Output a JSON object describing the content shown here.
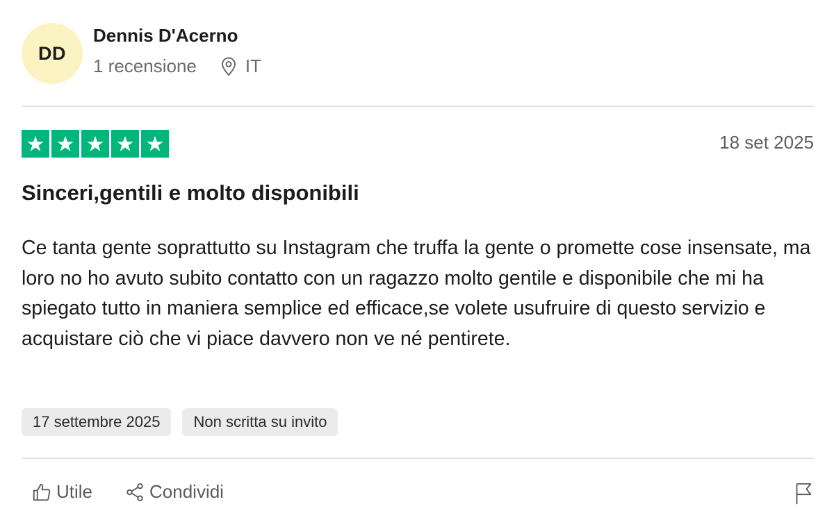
{
  "reviewer": {
    "initials": "DD",
    "name": "Dennis D'Acerno",
    "review_count": "1 recensione",
    "country": "IT",
    "location_icon": "location-pin-icon"
  },
  "review": {
    "rating": 5,
    "max_rating": 5,
    "star_color": "#00b67a",
    "date": "18 set 2025",
    "title": "Sinceri,gentili e molto disponibili",
    "text": "Ce tanta gente soprattutto su Instagram che truffa la gente o promette cose insensate, ma loro no ho avuto subito contatto con un ragazzo molto gentile e disponibile che mi ha spiegato tutto in maniera semplice ed efficace,se volete usufruire di questo servizio e acquistare ciò che vi piace davvero non ve né pentirete."
  },
  "tags": {
    "experience_date": "17 settembre 2025",
    "invite_status": "Non scritta su invito"
  },
  "actions": {
    "useful_label": "Utile",
    "useful_icon": "thumbs-up-icon",
    "share_label": "Condividi",
    "share_icon": "share-icon",
    "report_icon": "flag-icon"
  },
  "colors": {
    "avatar_bg": "#fcf3c2",
    "tag_bg": "#ebebeb"
  }
}
